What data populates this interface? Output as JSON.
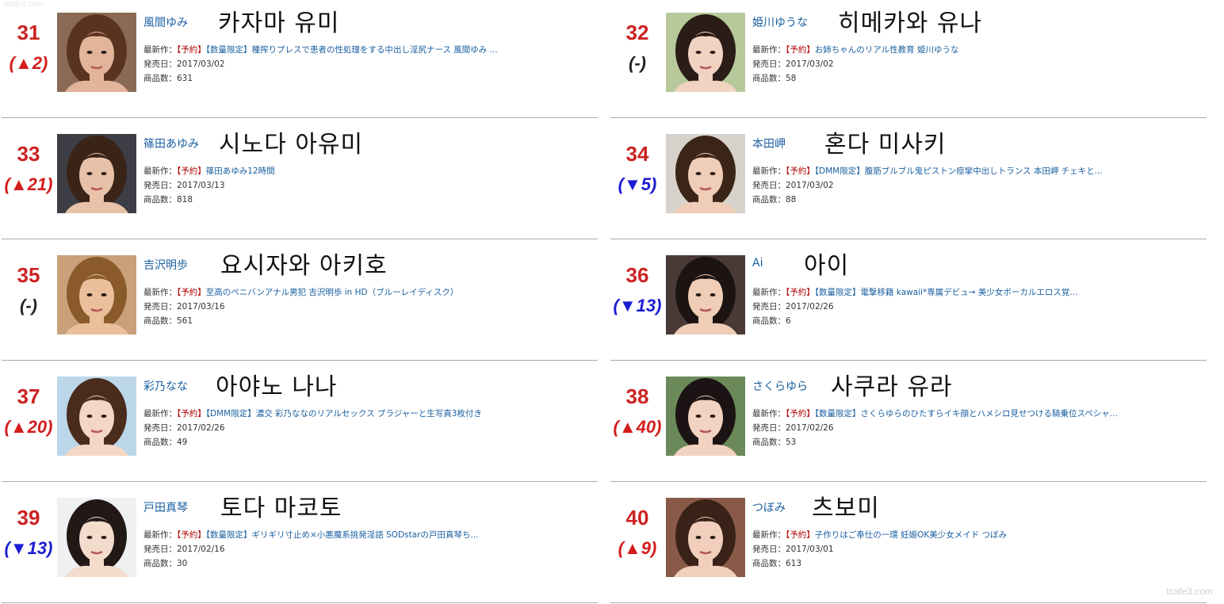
{
  "labels": {
    "latest": "最新作：",
    "release": "発売日：",
    "count": "商品数："
  },
  "watermark": "tcafe3.com",
  "watermark_top": "tcafe3.com",
  "colors": {
    "up": "#d41c1c",
    "down": "#1c1cd4",
    "same": "#222222",
    "rank": "#cc2222"
  },
  "entries": [
    {
      "rank": "31",
      "change": "(▲2)",
      "direction": "up",
      "jp_name": "風間ゆみ",
      "kr_name": "카자마 유미",
      "tag": "【予約】",
      "work": "【数量限定】種搾りプレスで患者の性処理をする中出し淫尻ナース 風間ゆみ ...",
      "release": "2017/03/02",
      "count": "631",
      "hair": "#5a3320",
      "skin": "#e2b49a",
      "bg": "#8a6a55"
    },
    {
      "rank": "32",
      "change": "(-)",
      "direction": "same",
      "jp_name": "姫川ゆうな",
      "kr_name": "히메카와 유나",
      "tag": "【予約】",
      "work": "お姉ちゃんのリアル性教育 姫川ゆうな",
      "release": "2017/03/02",
      "count": "58",
      "hair": "#2a1c16",
      "skin": "#f1d3c2",
      "bg": "#b7c99a"
    },
    {
      "rank": "33",
      "change": "(▲21)",
      "direction": "up",
      "jp_name": "篠田あゆみ",
      "kr_name": "시노다 아유미",
      "tag": "【予約】",
      "work": "篠田あゆみ12時間",
      "release": "2017/03/13",
      "count": "818",
      "hair": "#3a2418",
      "skin": "#e8c2a8",
      "bg": "#3d3d45"
    },
    {
      "rank": "34",
      "change": "(▼5)",
      "direction": "down",
      "jp_name": "本田岬",
      "kr_name": "혼다 미사키",
      "tag": "【予約】",
      "work": "【DMM限定】腹筋ブルブル鬼ピストン痙攣中出しトランス 本田岬 チェキと...",
      "release": "2017/03/02",
      "count": "88",
      "hair": "#3b2518",
      "skin": "#f0cdb8",
      "bg": "#d8d2cc"
    },
    {
      "rank": "35",
      "change": "(-)",
      "direction": "same",
      "jp_name": "吉沢明歩",
      "kr_name": "요시자와 아키호",
      "tag": "【予約】",
      "work": "至高のペニバンアナル男犯 吉沢明歩 in HD（ブルーレイディスク）",
      "release": "2017/03/16",
      "count": "561",
      "hair": "#8a5a2a",
      "skin": "#e9bf9c",
      "bg": "#c9a07a"
    },
    {
      "rank": "36",
      "change": "(▼13)",
      "direction": "down",
      "jp_name": "Ai",
      "kr_name": "아이",
      "tag": "【予約】",
      "work": "【数量限定】電撃移籍 kawaii*専属デビュ→ 美少女ボーカルエロス覚...",
      "release": "2017/02/26",
      "count": "6",
      "hair": "#1c1412",
      "skin": "#efcdb6",
      "bg": "#4a3a36"
    },
    {
      "rank": "37",
      "change": "(▲20)",
      "direction": "up",
      "jp_name": "彩乃なな",
      "kr_name": "아야노 나나",
      "tag": "【予約】",
      "work": "【DMM限定】濃交 彩乃ななのリアルセックス ブラジャーと生写真3枚付き",
      "release": "2017/02/26",
      "count": "49",
      "hair": "#4a2c1c",
      "skin": "#f3d6c4",
      "bg": "#bcd6ea"
    },
    {
      "rank": "38",
      "change": "(▲40)",
      "direction": "up",
      "jp_name": "さくらゆら",
      "kr_name": "사쿠라 유라",
      "tag": "【予約】",
      "work": "【数量限定】さくらゆらのひたすらイキ顔とハメシロ見せつける騎乗位スペシャ...",
      "release": "2017/02/26",
      "count": "53",
      "hair": "#1c1414",
      "skin": "#f2d2c0",
      "bg": "#6b8a5a"
    },
    {
      "rank": "39",
      "change": "(▼13)",
      "direction": "down",
      "jp_name": "戸田真琴",
      "kr_name": "토다 마코토",
      "tag": "【予約】",
      "work": "【数量限定】ギリギリ寸止め×小悪魔系挑発淫語 SODstarの戸田真琴ち...",
      "release": "2017/02/16",
      "count": "30",
      "hair": "#221816",
      "skin": "#f4dccd",
      "bg": "#eef0f2"
    },
    {
      "rank": "40",
      "change": "(▲9)",
      "direction": "up",
      "jp_name": "つぼみ",
      "kr_name": "츠보미",
      "tag": "【予約】",
      "work": "子作りはご奉仕の一環 妊娠OK美少女メイド つぼみ",
      "release": "2017/03/01",
      "count": "613",
      "hair": "#3a2218",
      "skin": "#f1cfbc",
      "bg": "#8a5a48"
    }
  ]
}
